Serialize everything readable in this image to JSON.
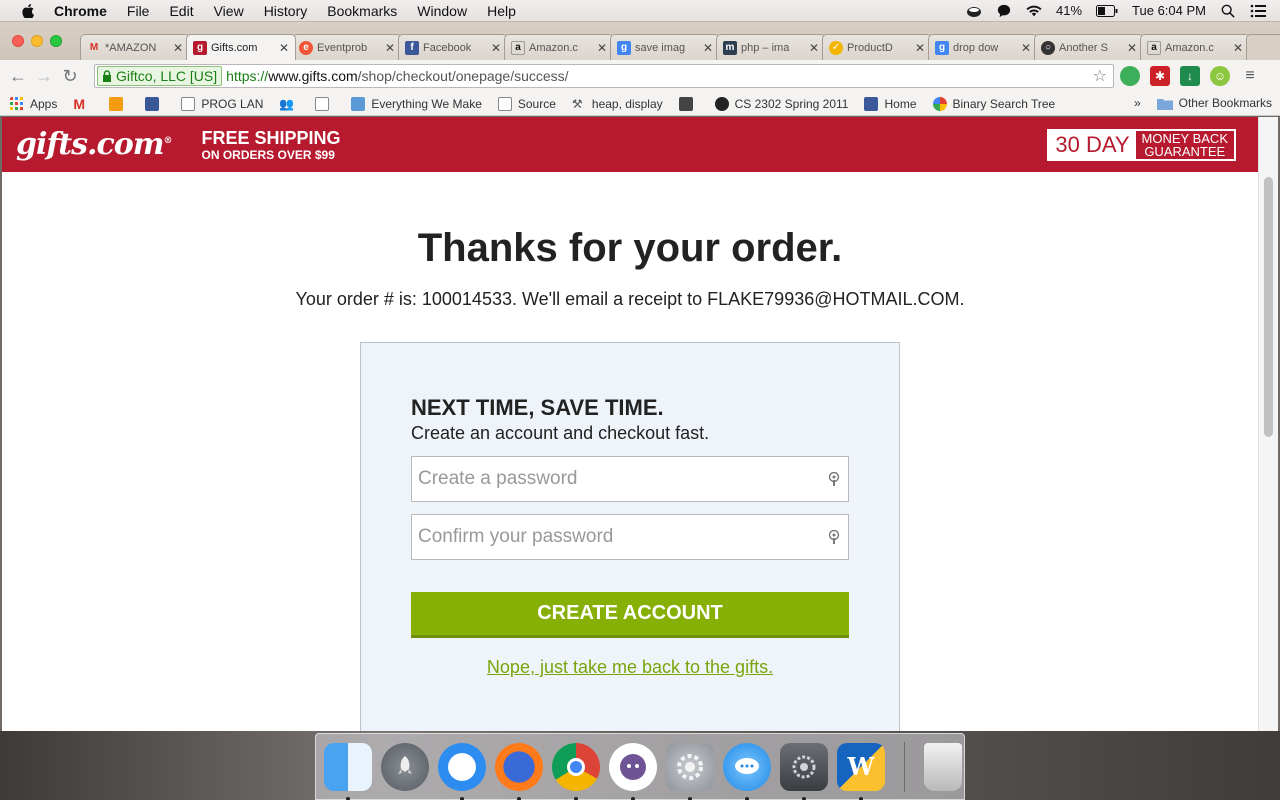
{
  "menubar": {
    "app_name": "Chrome",
    "items": [
      "File",
      "Edit",
      "View",
      "History",
      "Bookmarks",
      "Window",
      "Help"
    ],
    "battery": "41%",
    "clock": "Tue 6:04 PM"
  },
  "tabs": [
    {
      "title": "*AMAZON",
      "icon": "gmail-icon",
      "color": "#d93025"
    },
    {
      "title": "Gifts.com",
      "icon": "gifts-icon",
      "color": "#b71a2e"
    },
    {
      "title": "Eventprob",
      "icon": "eventbrite-icon",
      "color": "#f05537"
    },
    {
      "title": "Facebook",
      "icon": "facebook-icon",
      "color": "#3b5998"
    },
    {
      "title": "Amazon.c",
      "icon": "amazon-icon",
      "color": "#ffffff"
    },
    {
      "title": "save imag",
      "icon": "google-icon",
      "color": "#4285f4"
    },
    {
      "title": "php – ima",
      "icon": "php-icon",
      "color": "#2c3e50"
    },
    {
      "title": "ProductD",
      "icon": "check-icon",
      "color": "#f4b400"
    },
    {
      "title": "drop dow",
      "icon": "google-icon",
      "color": "#4285f4"
    },
    {
      "title": "Another S",
      "icon": "github-icon",
      "color": "#333333"
    },
    {
      "title": "Amazon.c",
      "icon": "amazon-icon",
      "color": "#ffffff"
    }
  ],
  "toolbar": {
    "ev_label": "Giftco, LLC [US]",
    "url_scheme": "https://",
    "url_host": "www.gifts.com",
    "url_path": "/shop/checkout/onepage/success/"
  },
  "bookmarks": {
    "items": [
      {
        "label": "Apps",
        "icon": "apps-icon"
      },
      {
        "label": "",
        "icon": "gmail-icon"
      },
      {
        "label": "",
        "icon": "mail-icon"
      },
      {
        "label": "",
        "icon": "facebook-icon"
      },
      {
        "label": "PROG LAN",
        "icon": "page-icon"
      },
      {
        "label": "",
        "icon": "people-icon"
      },
      {
        "label": "",
        "icon": "page-icon"
      },
      {
        "label": "Everything We Make",
        "icon": "blue-square-icon"
      },
      {
        "label": "Source",
        "icon": "page-icon"
      },
      {
        "label": "heap, display",
        "icon": "tool-icon"
      },
      {
        "label": "",
        "icon": "image-icon"
      },
      {
        "label": "CS 2302 Spring 2011",
        "icon": "utep-icon"
      },
      {
        "label": "Home",
        "icon": "facebook-icon"
      },
      {
        "label": "Binary Search Tree",
        "icon": "multi-icon"
      }
    ],
    "more": "»",
    "other": "Other Bookmarks"
  },
  "site": {
    "logo": "gifts.com",
    "logo_mark": "®",
    "shipping_line1": "FREE SHIPPING",
    "shipping_line2": "ON ORDERS OVER $99",
    "guarantee_big": "30 DAY",
    "guarantee_small1": "MONEY BACK",
    "guarantee_small2": "GUARANTEE"
  },
  "main": {
    "thanks": "Thanks for your order.",
    "order_line": "Your order # is: 100014533. We'll email a receipt to FLAKE79936@HOTMAIL.COM."
  },
  "account": {
    "heading": "NEXT TIME, SAVE TIME.",
    "subheading": "Create an account and checkout fast.",
    "password_placeholder": "Create a password",
    "confirm_placeholder": "Confirm your password",
    "create_button": "CREATE ACCOUNT",
    "decline_link": "Nope, just take me back to the gifts."
  },
  "dock": [
    "finder-icon",
    "launchpad-icon",
    "safari-icon",
    "firefox-icon",
    "chrome-icon",
    "github-icon",
    "system-preferences-icon",
    "messages-icon",
    "utilities-icon",
    "word-icon",
    "trash-icon"
  ]
}
